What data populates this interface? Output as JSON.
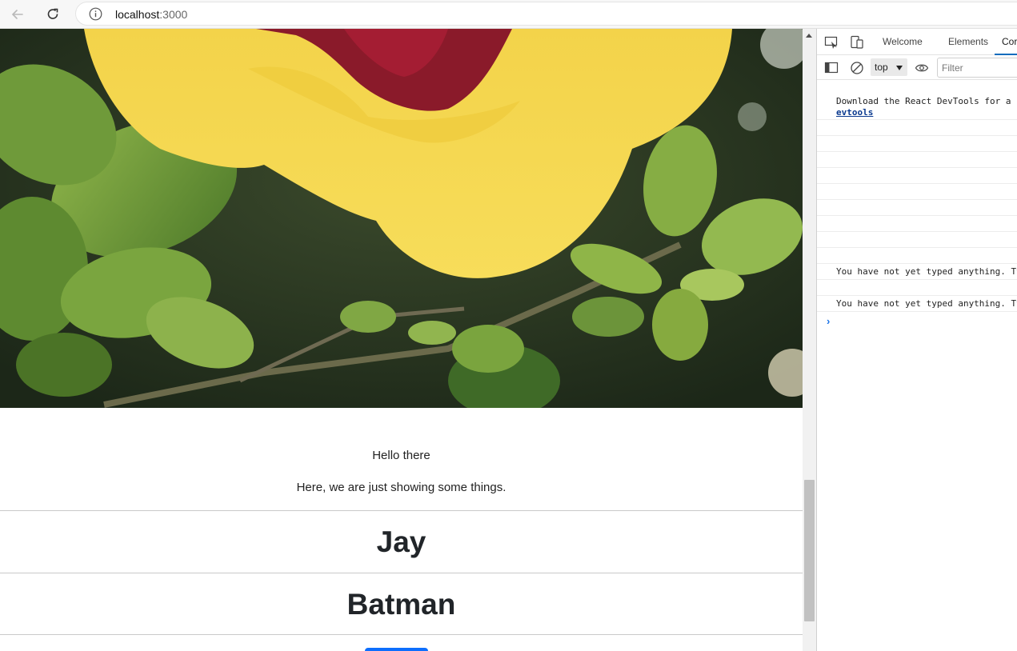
{
  "browser": {
    "url_host": "localhost",
    "url_port": ":3000",
    "icons": {
      "back": "back-arrow-icon",
      "reload": "reload-icon",
      "info": "info-icon"
    }
  },
  "page": {
    "greeting": "Hello there",
    "tagline": "Here, we are just showing some things.",
    "names": [
      "Jay",
      "Batman"
    ],
    "accent": "#0d6efd",
    "hero_alt": "yellow-hibiscus-flower-photo"
  },
  "devtools": {
    "tabs": [
      {
        "label": "Welcome"
      },
      {
        "label": "Elements"
      },
      {
        "label": "Cor"
      }
    ],
    "context_select": "top",
    "filter_placeholder": "Filter",
    "console": {
      "messages": [
        {
          "line1": "Download the React DevTools for a b",
          "link": "evtools"
        },
        {
          "text": "You have not yet typed anything. Ty"
        },
        {
          "text": "You have not yet typed anything. Ty"
        }
      ],
      "prompt": "›"
    },
    "accent": "#0f6cbd"
  }
}
